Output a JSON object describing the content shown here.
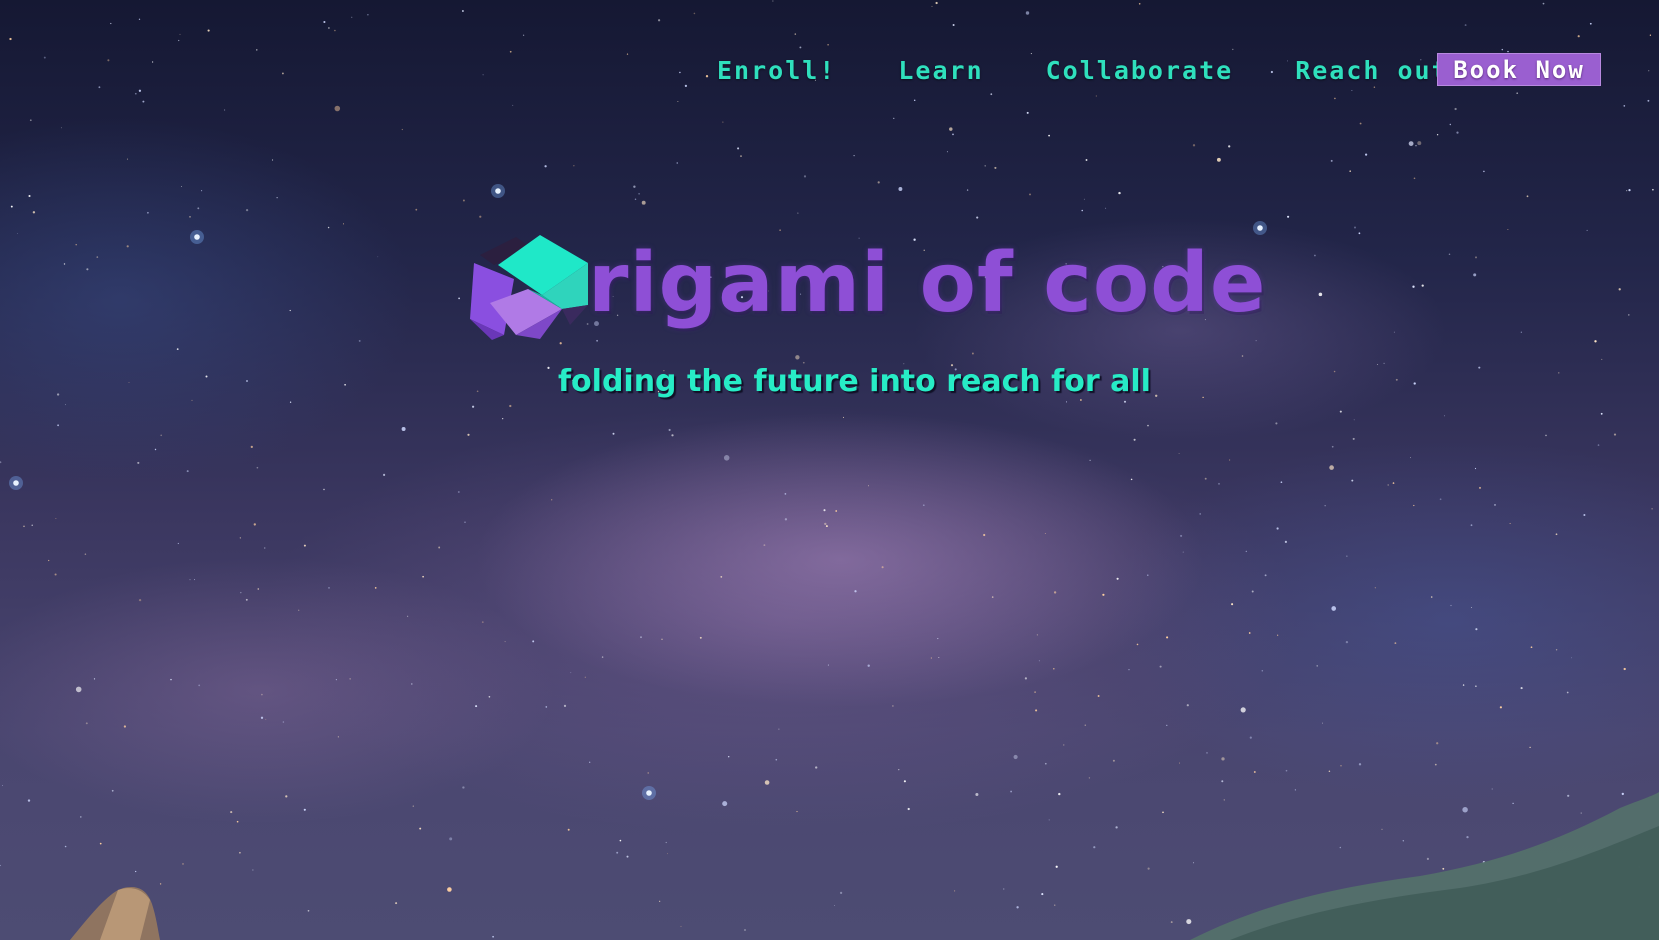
{
  "nav": {
    "links": [
      {
        "label": "Enroll!"
      },
      {
        "label": "Learn"
      },
      {
        "label": "Collaborate"
      },
      {
        "label": "Reach out"
      }
    ],
    "cta_label": "Book Now"
  },
  "hero": {
    "brand_name": "rigami of code",
    "tagline": "folding the future into reach for all",
    "logo_icon": "origami-diamond-icon"
  },
  "colors": {
    "accent_teal": "#2fe0bd",
    "brand_purple": "#8e4fd6",
    "button_purple": "#9a5fd0"
  }
}
